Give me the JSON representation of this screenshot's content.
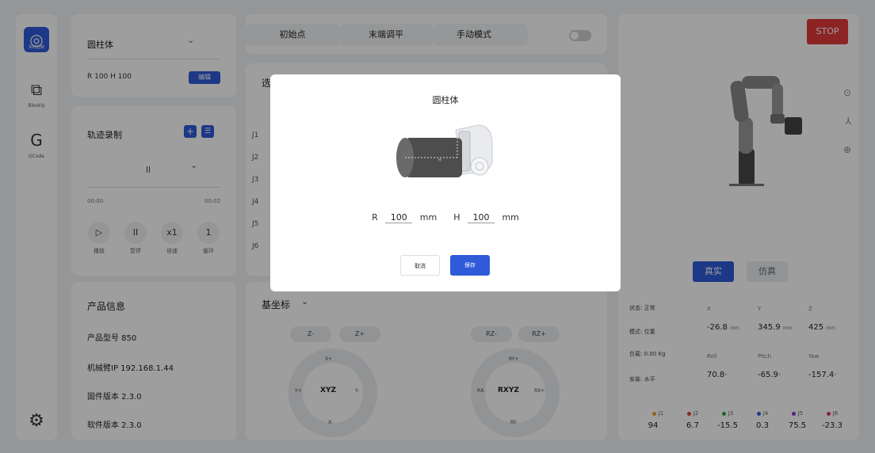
{
  "sidebar": {
    "items": [
      {
        "label": "实时控制",
        "icon": "joystick-icon",
        "glyph": "◎"
      },
      {
        "label": "Blockly",
        "icon": "puzzle-icon",
        "glyph": "⧉"
      },
      {
        "label": "GCode",
        "icon": "gcode-icon",
        "glyph": "G"
      }
    ],
    "settings_glyph": "⚙"
  },
  "model_card": {
    "select_value": "圆柱体",
    "chevron": "⌄",
    "params": "R 100 H 100",
    "edit_label": "编辑"
  },
  "track_card": {
    "title": "轨迹录制",
    "add_glyph": "+",
    "list_glyph": "☰",
    "select_value": "ll",
    "chevron": "⌄",
    "time_start": "00:00",
    "time_end": "00:02",
    "controls": [
      {
        "glyph": "▷",
        "label": "播放"
      },
      {
        "glyph": "II",
        "label": "暂停"
      },
      {
        "glyph": "x1",
        "label": "倍速"
      },
      {
        "glyph": "1",
        "label": "循环"
      }
    ]
  },
  "info_card": {
    "title": "产品信息",
    "rows": [
      "产品型号 850",
      "机械臂IP 192.168.1.44",
      "固件版本 2.3.0",
      "软件版本 2.3.0"
    ]
  },
  "top_bar": {
    "home_label": "初始点",
    "level_label": "末端调平",
    "manual_label": "手动模式"
  },
  "joints_card": {
    "title_partial": "选",
    "joints": [
      "J1",
      "J2",
      "J3",
      "J4",
      "J5",
      "J6"
    ]
  },
  "coord_card": {
    "title": "基坐标",
    "chevron": "⌄",
    "linear": {
      "minus": "Z-",
      "plus": "Z+",
      "top": "X+",
      "left": "Y+",
      "center": "XYZ",
      "right": "Y-",
      "bottom": "X-"
    },
    "rotary": {
      "minus": "RZ-",
      "plus": "RZ+",
      "top": "RY+",
      "left": "RX-",
      "center": "RXYZ",
      "right": "RX+",
      "bottom": "RY-"
    }
  },
  "right_panel": {
    "stop_label": "STOP",
    "mode_real": "真实",
    "mode_sim": "仿真",
    "status": [
      "状态: 正常",
      "模式: 位置",
      "负载: 0.00 Kg",
      "安装: 水平"
    ],
    "axes": [
      {
        "label": "X",
        "value": "-26.8",
        "unit": "mm"
      },
      {
        "label": "Y",
        "value": "345.9",
        "unit": "mm"
      },
      {
        "label": "Z",
        "value": "425",
        "unit": "mm"
      },
      {
        "label": "Roll",
        "value": "70.8",
        "unit": "°"
      },
      {
        "label": "Pitch",
        "value": "-65.9",
        "unit": "°"
      },
      {
        "label": "Yaw",
        "value": "-157.4",
        "unit": "°"
      }
    ],
    "joints": [
      {
        "label": "J1",
        "value": "94",
        "color": "#f0a030"
      },
      {
        "label": "J2",
        "value": "6.7",
        "color": "#e03a3a"
      },
      {
        "label": "J3",
        "value": "-15.5",
        "color": "#28a745"
      },
      {
        "label": "J4",
        "value": "0.3",
        "color": "#2f5bd9"
      },
      {
        "label": "J5",
        "value": "75.5",
        "color": "#8a3ad9"
      },
      {
        "label": "J6",
        "value": "-23.3",
        "color": "#e0307a"
      }
    ]
  },
  "modal": {
    "title": "圆柱体",
    "r_label": "R",
    "r_value": "100",
    "h_label": "H",
    "h_value": "100",
    "unit": "mm",
    "cancel_label": "取消",
    "save_label": "保存"
  },
  "colors": {
    "accent": "#2f5bd9",
    "stop": "#e23a3a"
  }
}
